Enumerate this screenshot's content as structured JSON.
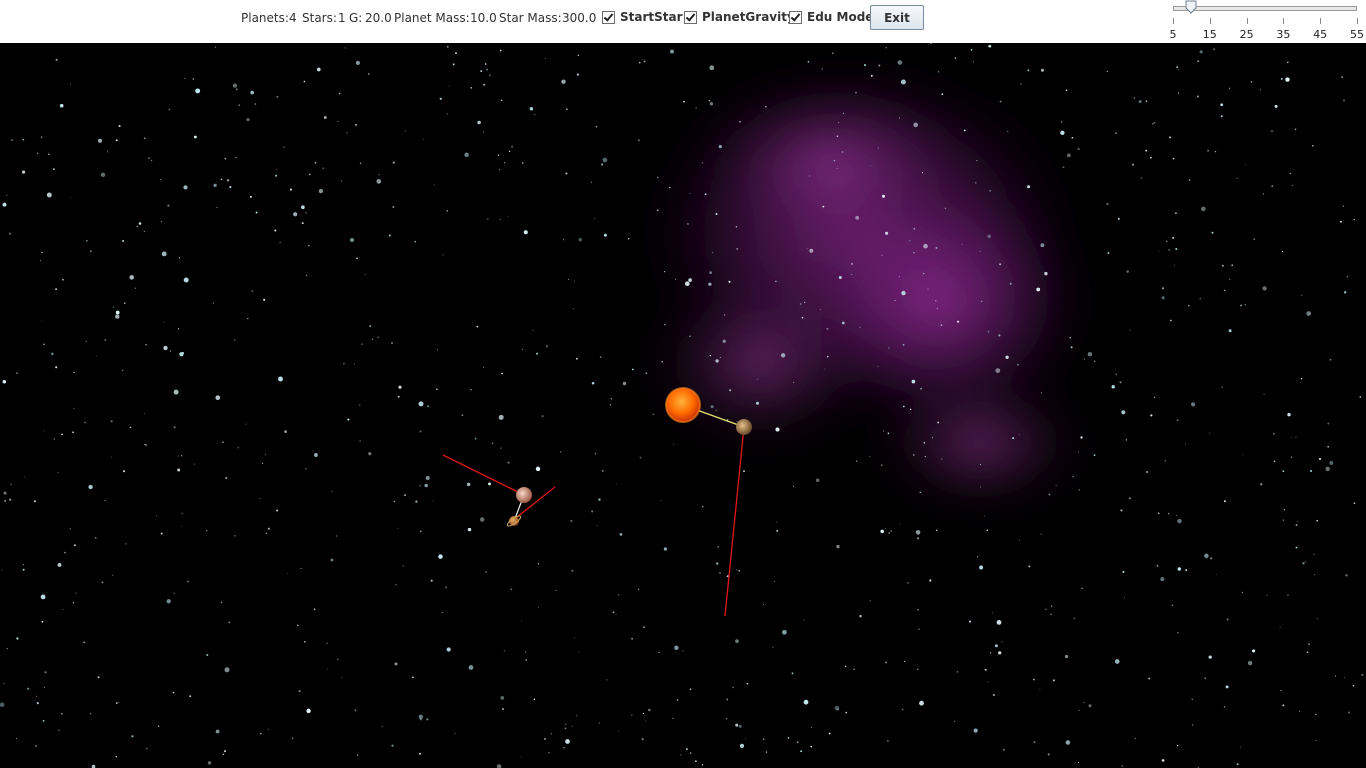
{
  "toolbar": {
    "planets_label": "Planets:",
    "planets_value": "4",
    "stars_label": "Stars:",
    "stars_value": "1",
    "g_label": "G:",
    "g_value": "20.0",
    "planet_mass_label": "Planet Mass:",
    "planet_mass_value": "10.0",
    "star_mass_label": "Star Mass:",
    "star_mass_value": "300.0",
    "checkboxes": [
      {
        "label": "StartStar",
        "checked": true
      },
      {
        "label": "PlanetGravity",
        "checked": true
      },
      {
        "label": "Edu Mode",
        "checked": true
      }
    ],
    "exit_label": "Exit"
  },
  "speed_slider": {
    "min": 5,
    "max": 55,
    "value": 10,
    "tick_labels": [
      "5",
      "15",
      "25",
      "35",
      "45",
      "55"
    ]
  },
  "colors": {
    "space": "#000000",
    "nebula": "#8b2a8f",
    "star_body": "#ff6a00",
    "force_line": "#e01818",
    "link_line": "#e8e070"
  }
}
